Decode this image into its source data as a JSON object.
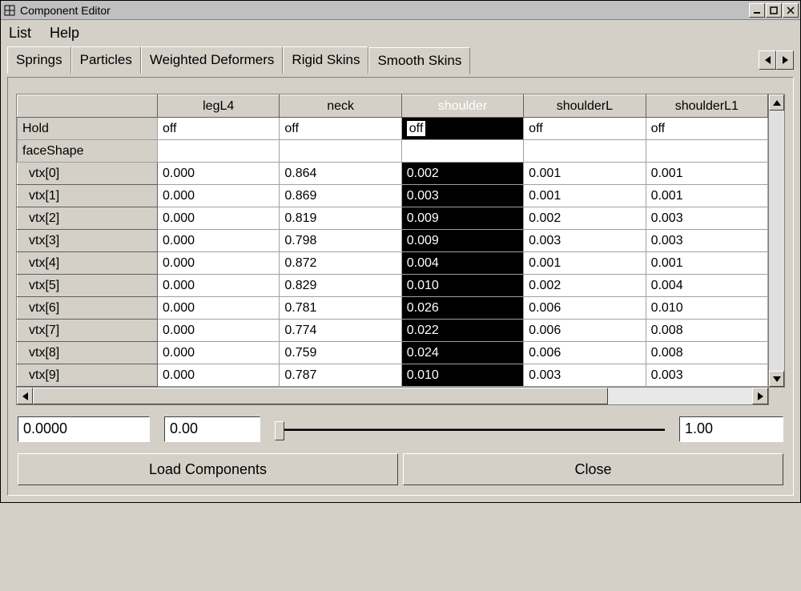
{
  "window": {
    "title": "Component Editor"
  },
  "menu": {
    "items": [
      "List",
      "Help"
    ]
  },
  "tabs": {
    "items": [
      "Springs",
      "Particles",
      "Weighted Deformers",
      "Rigid Skins",
      "Smooth Skins"
    ],
    "active_index": 4
  },
  "columns": [
    "legL4",
    "neck",
    "shoulder",
    "shoulderL",
    "shoulderL1"
  ],
  "selected_column_index": 2,
  "rows": [
    {
      "label": "Hold",
      "kind": "hold",
      "values": [
        "off",
        "off",
        "off",
        "off",
        "off"
      ],
      "edit": true
    },
    {
      "label": "faceShape",
      "kind": "section",
      "values": [
        "",
        "",
        "",
        "",
        ""
      ]
    },
    {
      "label": "vtx[0]",
      "kind": "vtx",
      "values": [
        "0.000",
        "0.864",
        "0.002",
        "0.001",
        "0.001"
      ]
    },
    {
      "label": "vtx[1]",
      "kind": "vtx",
      "values": [
        "0.000",
        "0.869",
        "0.003",
        "0.001",
        "0.001"
      ]
    },
    {
      "label": "vtx[2]",
      "kind": "vtx",
      "values": [
        "0.000",
        "0.819",
        "0.009",
        "0.002",
        "0.003"
      ]
    },
    {
      "label": "vtx[3]",
      "kind": "vtx",
      "values": [
        "0.000",
        "0.798",
        "0.009",
        "0.003",
        "0.003"
      ]
    },
    {
      "label": "vtx[4]",
      "kind": "vtx",
      "values": [
        "0.000",
        "0.872",
        "0.004",
        "0.001",
        "0.001"
      ]
    },
    {
      "label": "vtx[5]",
      "kind": "vtx",
      "values": [
        "0.000",
        "0.829",
        "0.010",
        "0.002",
        "0.004"
      ]
    },
    {
      "label": "vtx[6]",
      "kind": "vtx",
      "values": [
        "0.000",
        "0.781",
        "0.026",
        "0.006",
        "0.010"
      ]
    },
    {
      "label": "vtx[7]",
      "kind": "vtx",
      "values": [
        "0.000",
        "0.774",
        "0.022",
        "0.006",
        "0.008"
      ]
    },
    {
      "label": "vtx[8]",
      "kind": "vtx",
      "values": [
        "0.000",
        "0.759",
        "0.024",
        "0.006",
        "0.008"
      ]
    },
    {
      "label": "vtx[9]",
      "kind": "vtx",
      "values": [
        "0.000",
        "0.787",
        "0.010",
        "0.003",
        "0.003"
      ]
    }
  ],
  "inputs": {
    "value": "0.0000",
    "min": "0.00",
    "max": "1.00"
  },
  "buttons": {
    "load": "Load Components",
    "close": "Close"
  }
}
